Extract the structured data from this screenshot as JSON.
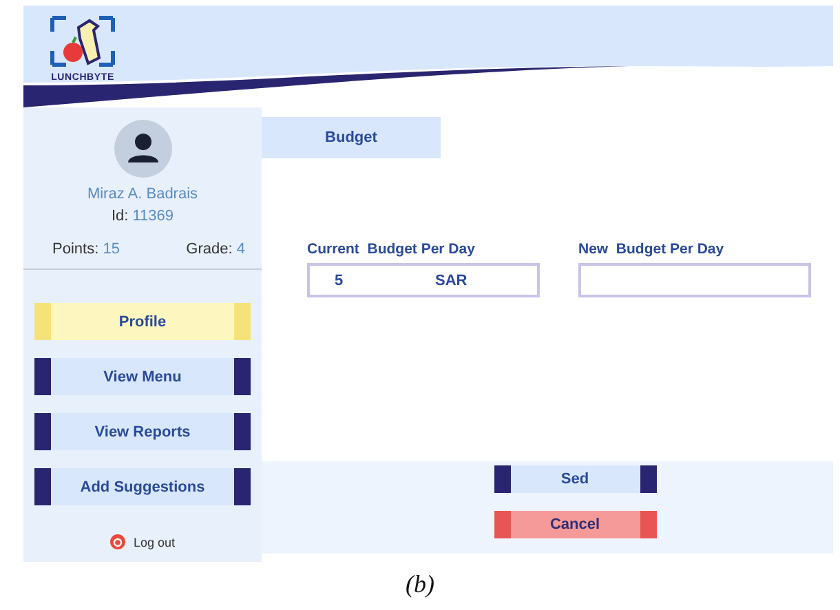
{
  "header": {
    "logo_text": "LUNCHBYTE"
  },
  "profile": {
    "name": "Miraz A. Badrais",
    "id_label": "Id:",
    "id_value": "11369",
    "points_label": "Points:",
    "points_value": "15",
    "grade_label": "Grade:",
    "grade_value": "4"
  },
  "nav": [
    {
      "label": "Profile",
      "selected": true
    },
    {
      "label": "View Menu",
      "selected": false
    },
    {
      "label": "View Reports",
      "selected": false
    },
    {
      "label": "Add Suggestions",
      "selected": false
    }
  ],
  "logout": {
    "label": "Log out"
  },
  "tab": {
    "label": "Budget"
  },
  "current_budget": {
    "label": "Current  Budget Per Day",
    "value": "5",
    "unit": "SAR"
  },
  "new_budget": {
    "label": "New  Budget Per Day"
  },
  "actions": [
    {
      "label": "Sed",
      "kind": "primary"
    },
    {
      "label": "Cancel",
      "kind": "danger"
    }
  ],
  "caption": "(b)"
}
